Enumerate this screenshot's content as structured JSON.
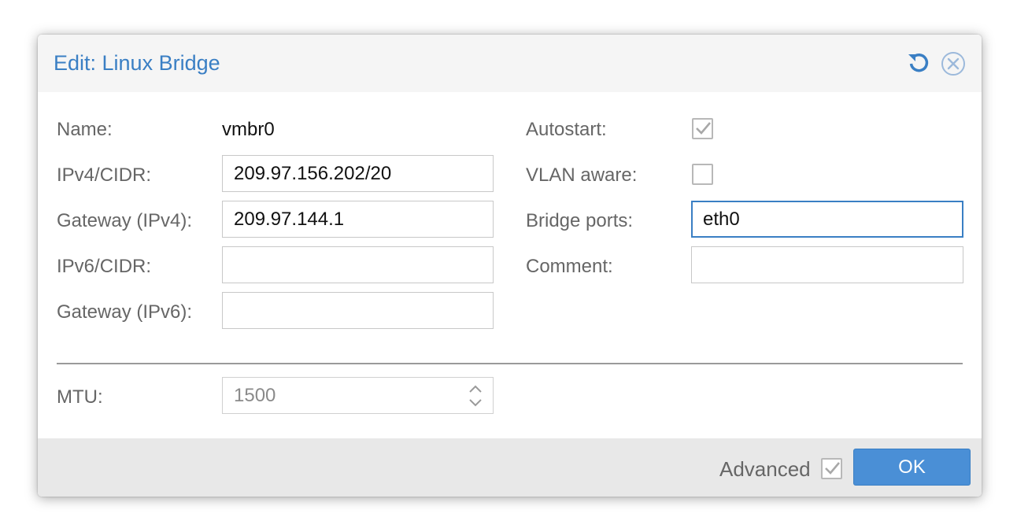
{
  "dialog": {
    "title": "Edit: Linux Bridge",
    "reset_icon": "reset-icon",
    "close_icon": "close-icon"
  },
  "form": {
    "name": {
      "label": "Name:",
      "value": "vmbr0"
    },
    "ipv4_cidr": {
      "label": "IPv4/CIDR:",
      "value": "209.97.156.202/20"
    },
    "gateway_ipv4": {
      "label": "Gateway (IPv4):",
      "value": "209.97.144.1"
    },
    "ipv6_cidr": {
      "label": "IPv6/CIDR:",
      "value": ""
    },
    "gateway_ipv6": {
      "label": "Gateway (IPv6):",
      "value": ""
    },
    "autostart": {
      "label": "Autostart:",
      "checked": true
    },
    "vlan_aware": {
      "label": "VLAN aware:",
      "checked": false
    },
    "bridge_ports": {
      "label": "Bridge ports:",
      "value": "eth0"
    },
    "comment": {
      "label": "Comment:",
      "value": ""
    },
    "mtu": {
      "label": "MTU:",
      "value": "1500"
    }
  },
  "footer": {
    "advanced_label": "Advanced",
    "advanced_checked": true,
    "ok_label": "OK"
  },
  "colors": {
    "accent": "#3a7fc4",
    "ok_button": "#4a8fd6",
    "label": "#666666"
  }
}
